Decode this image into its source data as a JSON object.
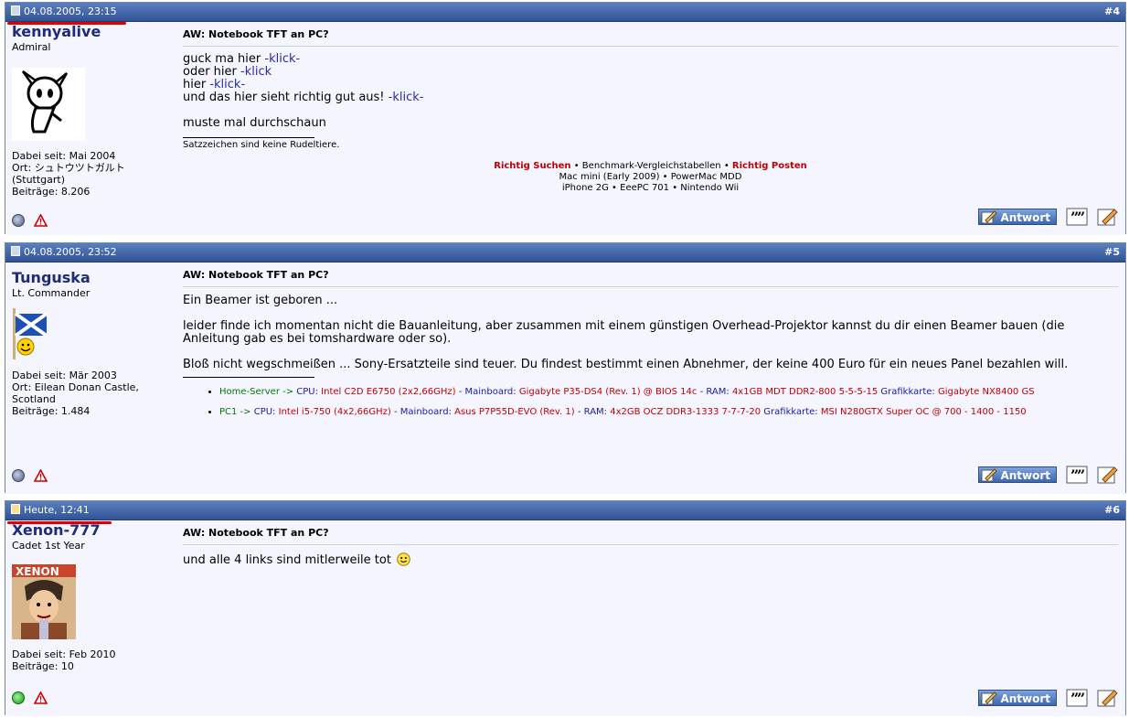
{
  "posts": [
    {
      "date": "04.08.2005, 23:15",
      "number": "#4",
      "username": "kennyalive",
      "rank": "Admiral",
      "joined": "Dabei seit: Mai 2004",
      "location": "Ort: シュトウツトガルト (Stuttgart)",
      "posts": "Beiträge: 8.206",
      "title": "AW: Notebook TFT an PC?",
      "lines": [
        {
          "text": "guck ma hier ",
          "link": "-klick-"
        },
        {
          "text": "oder hier ",
          "link": "-klick"
        },
        {
          "text": "hier ",
          "link": "-klick-"
        },
        {
          "text": "und das hier sieht richtig gut aus! ",
          "link": "-klick-"
        }
      ],
      "closing": "muste mal durchschaun",
      "signature_text": "Satzzeichen sind keine Rudeltiere.",
      "sig_links": {
        "search": "Richtig Suchen",
        "bench": " • Benchmark-Vergleichstabellen • ",
        "posting": "Richtig Posten",
        "line2": "Mac mini (Early 2009) • PowerMac MDD",
        "line3": "iPhone 2G • EeePC 701 • Nintendo Wii"
      },
      "online": false
    },
    {
      "date": "04.08.2005, 23:52",
      "number": "#5",
      "username": "Tunguska",
      "rank": "Lt. Commander",
      "joined": "Dabei seit: Mär 2003",
      "location": "Ort: Eilean Donan Castle, Scotland",
      "posts": "Beiträge: 1.484",
      "title": "AW: Notebook TFT an PC?",
      "p1": "Ein Beamer ist geboren ...",
      "p2": "leider finde ich momentan nicht die Bauanleitung, aber zusammen mit einem günstigen Overhead-Projektor kannst du dir einen Beamer bauen (die Anleitung gab es bei tomshardware oder so).",
      "p3": "Bloß nicht wegschmeißen ... Sony-Ersatzteile sind teuer. Du findest bestimmt einen Abnehmer, der keine 400 Euro für ein neues Panel bezahlen will.",
      "hw1": {
        "name": "Home-Server ->",
        "cpu_l": " CPU:",
        "cpu": " Intel C2D E6750 (2x2,66GHz)",
        "mb_l": " - Mainboard:",
        "mb": " Gigabyte P35-DS4 (Rev. 1) @ BIOS 14c",
        "ram_l": " - RAM:",
        "ram": " 4x1GB MDT DDR2-800 5-5-5-15",
        "gfx_l": " Grafikkarte:",
        "gfx": " Gigabyte NX8400 GS"
      },
      "hw2": {
        "name": "PC1 ->",
        "cpu_l": " CPU:",
        "cpu": " Intel i5-750 (4x2,66GHz)",
        "mb_l": " - Mainboard:",
        "mb": " Asus P7P55D-EVO (Rev. 1)",
        "ram_l": " - RAM:",
        "ram": " 4x2GB OCZ DDR3-1333 7-7-7-20",
        "gfx_l": " Grafikkarte:",
        "gfx": " MSI N280GTX Super OC @ 700 - 1400 - 1150"
      },
      "online": false
    },
    {
      "date": "Heute, 12:41",
      "number": "#6",
      "username": "Xenon-777",
      "rank": "Cadet 1st Year",
      "joined": "Dabei seit: Feb 2010",
      "posts": "Beiträge: 10",
      "title": "AW: Notebook TFT an PC?",
      "message": "und alle 4 links sind mitlerweile tot",
      "avatar_text": "XENON",
      "online": true
    }
  ],
  "buttons": {
    "reply": "Antwort"
  },
  "icons": {
    "doc": "document-icon",
    "online": "status-dot-icon",
    "report": "warning-icon",
    "quote": "quote-icon",
    "edit": "edit-icon"
  },
  "colors": {
    "header": "#3b5fa4",
    "username": "#1e2a7a",
    "sig_red": "#c00000"
  }
}
